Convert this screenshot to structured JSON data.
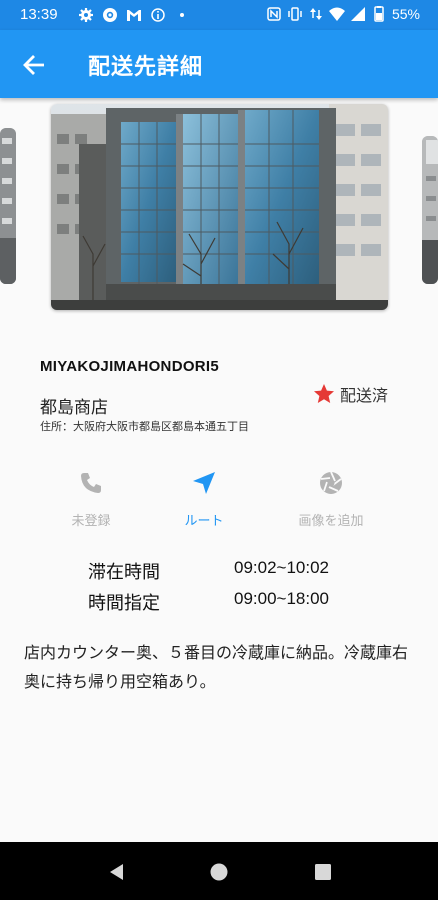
{
  "status_bar": {
    "time": "13:39",
    "battery": "55%",
    "left_icons": [
      "gear-icon",
      "target-icon",
      "gmail-icon",
      "info-icon",
      "dot-icon"
    ],
    "right_icons": [
      "nfc-icon",
      "vibrate-icon",
      "data-arrows-icon",
      "wifi-icon",
      "signal-icon",
      "battery-icon"
    ]
  },
  "app_bar": {
    "title": "配送先詳細",
    "back_icon": "arrow-left-icon"
  },
  "place": {
    "code": "MIYAKOJIMAHONDORI5",
    "name": "都島商店",
    "address": "住所：大阪府大阪市都島区都島本通五丁目",
    "status": "配送済",
    "status_icon": "star-icon",
    "status_color": "#e53935"
  },
  "actions": [
    {
      "label": "未登録",
      "icon": "phone-icon",
      "color": "#b3b3b3"
    },
    {
      "label": "ルート",
      "icon": "navigation-arrow-icon",
      "color": "#2196f3"
    },
    {
      "label": "画像を追加",
      "icon": "camera-shutter-icon",
      "color": "#b3b3b3"
    }
  ],
  "times": {
    "stay_label": "滞在時間",
    "stay_value": "09:02~10:02",
    "spec_label": "時間指定",
    "spec_value": "09:00~18:00"
  },
  "note": "店内カウンター奥、５番目の冷蔵庫に納品。冷蔵庫右奥に持ち帰り用空箱あり。",
  "colors": {
    "primary": "#2196f3",
    "status_bar": "#1e88e5",
    "accent_red": "#e53935"
  }
}
